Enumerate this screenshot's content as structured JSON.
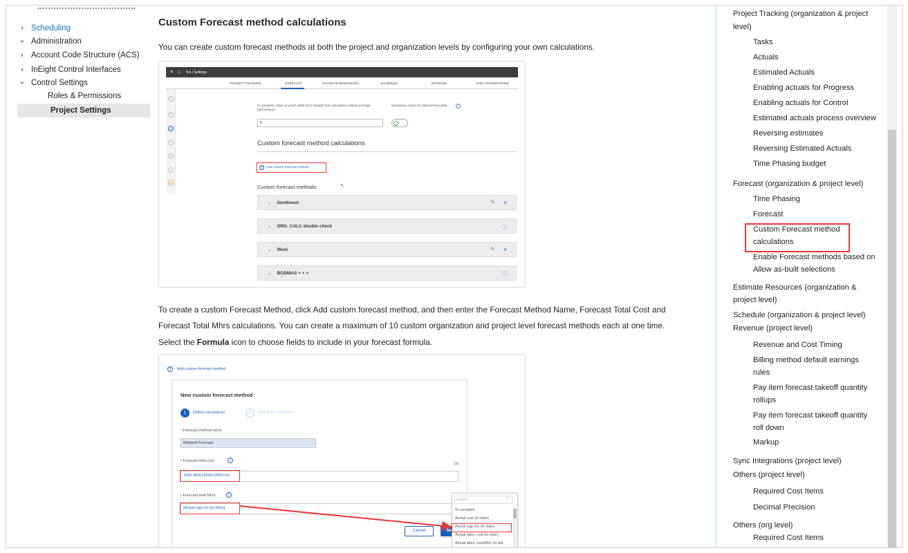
{
  "left_nav": {
    "items": [
      {
        "label": "Scheduling",
        "chev": "›",
        "blue": true
      },
      {
        "label": "Administration",
        "chev": "⌄"
      },
      {
        "label": "Account Code Structure (ACS)",
        "chev": "›"
      },
      {
        "label": "InEight Control Interfaces",
        "chev": "›"
      },
      {
        "label": "Control Settings",
        "chev": "⌄"
      },
      {
        "label": "Roles & Permissions"
      },
      {
        "label": "Project Settings",
        "selected": true
      }
    ]
  },
  "main": {
    "title": "Custom Forecast method calculations",
    "intro": "You can create custom forecast methods at both the project and organization levels by configuring your own calculations.",
    "para1_line1": "To create a custom Forecast Method, click Add custom forecast method, and then enter the Forecast Method Name, Forecast Total Cost and",
    "para1_line2": "Forecast Total Mhrs calculations. You can create a maximum of 10 custom organization and project level forecast methods each at one time.",
    "para2_prefix": "Select the ",
    "para2_bold": "Formula",
    "para2_suffix": " icon to choose fields to include in your forecast formula."
  },
  "shot1": {
    "breadcrumb": "Ten  /  Settings",
    "tabs": [
      "PROJECT TRACKING",
      "FORECAST",
      "ESTIMATE RESOURCES",
      "SCHEDULE",
      "REVENUE",
      "SYNC INTEGRATIONS"
    ],
    "delta_label": "% complete value at which delta from straight line calculation utilizes average performance",
    "delta_value": "5",
    "mandatory_label": "Mandatory notes for Manual forecasts",
    "section_title": "Custom forecast method calculations",
    "add_link": "Add custom forecast method",
    "methods_title": "Custom forecast methods",
    "methods": [
      "Southeast",
      "ORG_CALC double check",
      "West",
      "BODMAS + + +"
    ]
  },
  "shot2": {
    "add_link": "Add custom forecast method",
    "dialog_title": "New custom forecast method",
    "step1": "Define calculations",
    "step2": "Enable for cost items",
    "name_label": "• Forecast method name",
    "name_value": "Midwest Forecast",
    "cost_label": "• Forecast total cost",
    "cost_value": "1000-4000+6000+3000+10",
    "mhrs_label": "• Forecast total Mhrs",
    "mhrs_value": "[Actual egp hrs (to date)]",
    "formula_icon": "[x]",
    "search_placeholder": "Search...",
    "dropdown_items": [
      "% complete",
      "Actual cost (to date)",
      "Actual egp hrs (to date)",
      "Actual labor cost (to date)",
      "Actual labor cost/MHr (to dat"
    ],
    "cancel": "Cancel",
    "next": "Next"
  },
  "toc": {
    "items": [
      {
        "label": "Project Tracking (organization & project",
        "indent": 0
      },
      {
        "label": "level)",
        "indent": 0
      },
      {
        "label": "Tasks",
        "indent": 1
      },
      {
        "label": "Actuals",
        "indent": 1
      },
      {
        "label": "Estimated Actuals",
        "indent": 1
      },
      {
        "label": "Enabling actuals for Progress",
        "indent": 1
      },
      {
        "label": "Enabling actuals for Control",
        "indent": 1
      },
      {
        "label": "Estimated actuals process overview",
        "indent": 1
      },
      {
        "label": "Reversing estimates",
        "indent": 1
      },
      {
        "label": "Reversing Estimated Actuals",
        "indent": 1
      },
      {
        "label": "Time Phasing budget",
        "indent": 1
      },
      {
        "label": "Forecast (organization & project level)",
        "indent": 0
      },
      {
        "label": "Time Phasing",
        "indent": 1
      },
      {
        "label": "Forecast",
        "indent": 1
      },
      {
        "label": "Custom Forecast method",
        "indent": 1
      },
      {
        "label": "calculations",
        "indent": 1
      },
      {
        "label": "Enable Forecast methods based on",
        "indent": 1
      },
      {
        "label": "Allow as-built selections",
        "indent": 1
      },
      {
        "label": "Estimate Resources (organization &",
        "indent": 0
      },
      {
        "label": "project level)",
        "indent": 0
      },
      {
        "label": "Schedule (organization & project level)",
        "indent": 0
      },
      {
        "label": "Revenue (project level)",
        "indent": 0
      },
      {
        "label": "Revenue and Cost Timing",
        "indent": 1
      },
      {
        "label": "Billing method default earnings",
        "indent": 1
      },
      {
        "label": "rules",
        "indent": 1
      },
      {
        "label": "Pay item forecast takeoff quantity",
        "indent": 1
      },
      {
        "label": "rollups",
        "indent": 1
      },
      {
        "label": "Pay item forecast takeoff quantity",
        "indent": 1
      },
      {
        "label": "roll down",
        "indent": 1
      },
      {
        "label": "Markup",
        "indent": 1
      },
      {
        "label": "Sync Integrations (project level)",
        "indent": 0
      },
      {
        "label": "Others (project level)",
        "indent": 0
      },
      {
        "label": "Required Cost Items",
        "indent": 1
      },
      {
        "label": "Decimal Precision",
        "indent": 1
      },
      {
        "label": "Others (org level)",
        "indent": 0
      },
      {
        "label": "Required Cost Items",
        "indent": 1
      }
    ]
  },
  "colors": {
    "link": "#1a6fc4",
    "highlight": "#e33333",
    "accent": "#1a5fbf"
  }
}
